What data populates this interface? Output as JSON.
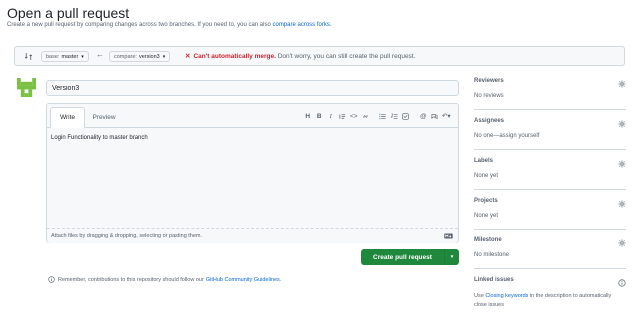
{
  "header": {
    "title": "Open a pull request",
    "subtitle": "Create a new pull request by comparing changes across two branches. If you need to, you can also",
    "subtitle_link": "compare across forks",
    "subtitle_end": "."
  },
  "compare": {
    "base_prefix": "base:",
    "base_branch": "master",
    "compare_prefix": "compare:",
    "compare_branch": "version3",
    "status_mark": "✕",
    "status_strong": "Can't automatically merge.",
    "status_rest": "Don't worry, you can still create the pull request."
  },
  "form": {
    "title_value": "Version3",
    "tabs": {
      "write": "Write",
      "preview": "Preview"
    },
    "toolbar": [
      "H",
      "B",
      "I"
    ],
    "body_text": "Login Functionality to master branch",
    "attach_hint": "Attach files by dragging & dropping, selecting or pasting them.",
    "submit_label": "Create pull request"
  },
  "footer_note": {
    "text": "Remember, contributions to this repository should follow our",
    "link": "GitHub Community Guidelines",
    "end": "."
  },
  "sidebar": {
    "reviewers": {
      "heading": "Reviewers",
      "value": "No reviews"
    },
    "assignees": {
      "heading": "Assignees",
      "value": "No one—assign yourself"
    },
    "labels": {
      "heading": "Labels",
      "value": "None yet"
    },
    "projects": {
      "heading": "Projects",
      "value": "None yet"
    },
    "milestone": {
      "heading": "Milestone",
      "value": "No milestone"
    },
    "linked_issues": {
      "heading": "Linked issues",
      "text_start": "Use",
      "link": "Closing keywords",
      "text_end": "in the description to automatically close issues"
    }
  },
  "colors": {
    "accent_link": "#0969da",
    "primary_button": "#1f883d",
    "danger": "#d1242f",
    "muted_text": "#59636e",
    "border": "#d1d9e0"
  },
  "icons": [
    "git-compare-icon",
    "arrow-left-icon",
    "x-icon",
    "avatar-identicon",
    "heading-icon",
    "bold-icon",
    "italic-icon",
    "quote-icon",
    "code-icon",
    "link-icon",
    "unordered-list-icon",
    "ordered-list-icon",
    "task-list-icon",
    "mention-icon",
    "cross-reference-icon",
    "reply-icon",
    "markdown-icon",
    "info-icon",
    "gear-icon"
  ]
}
